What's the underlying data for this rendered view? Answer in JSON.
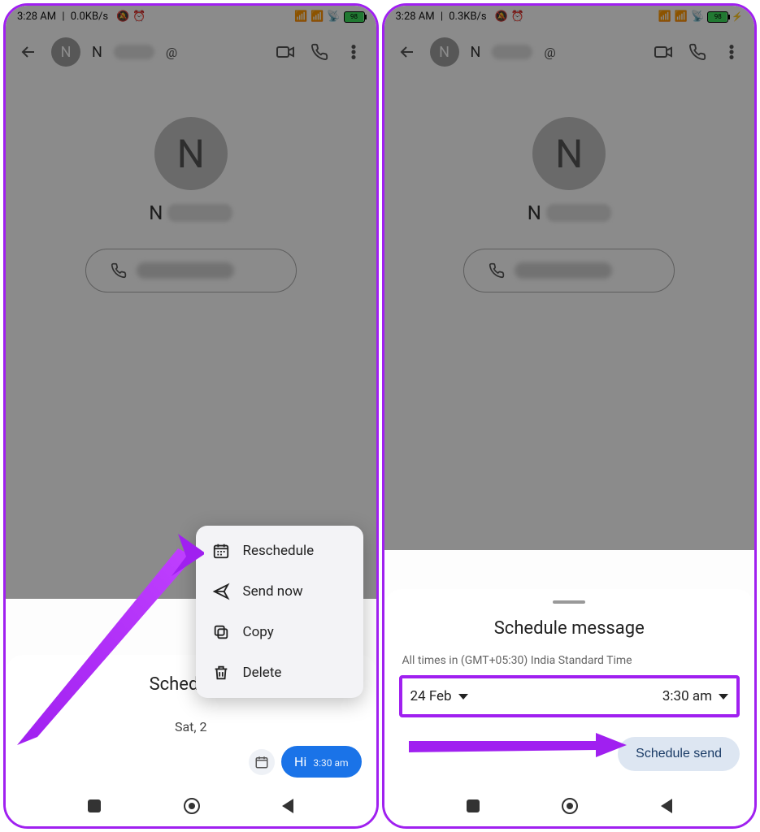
{
  "left": {
    "status": {
      "time": "3:28 AM",
      "net": "0.0KB/s",
      "battery": "98"
    },
    "contact": {
      "initial": "N",
      "name_prefix": "N"
    },
    "scheduled": {
      "title": "Scheduled",
      "date": "Sat, 2",
      "message": "Hi",
      "time": "3:30 am"
    },
    "menu": {
      "reschedule": "Reschedule",
      "send_now": "Send now",
      "copy": "Copy",
      "delete": "Delete"
    }
  },
  "right": {
    "status": {
      "time": "3:28 AM",
      "net": "0.3KB/s",
      "battery": "98"
    },
    "contact": {
      "initial": "N",
      "name_prefix": "N"
    },
    "sheet": {
      "title": "Schedule message",
      "timezone": "All times in (GMT+05:30) India Standard Time",
      "date": "24 Feb",
      "time": "3:30 am",
      "button": "Schedule send"
    }
  }
}
